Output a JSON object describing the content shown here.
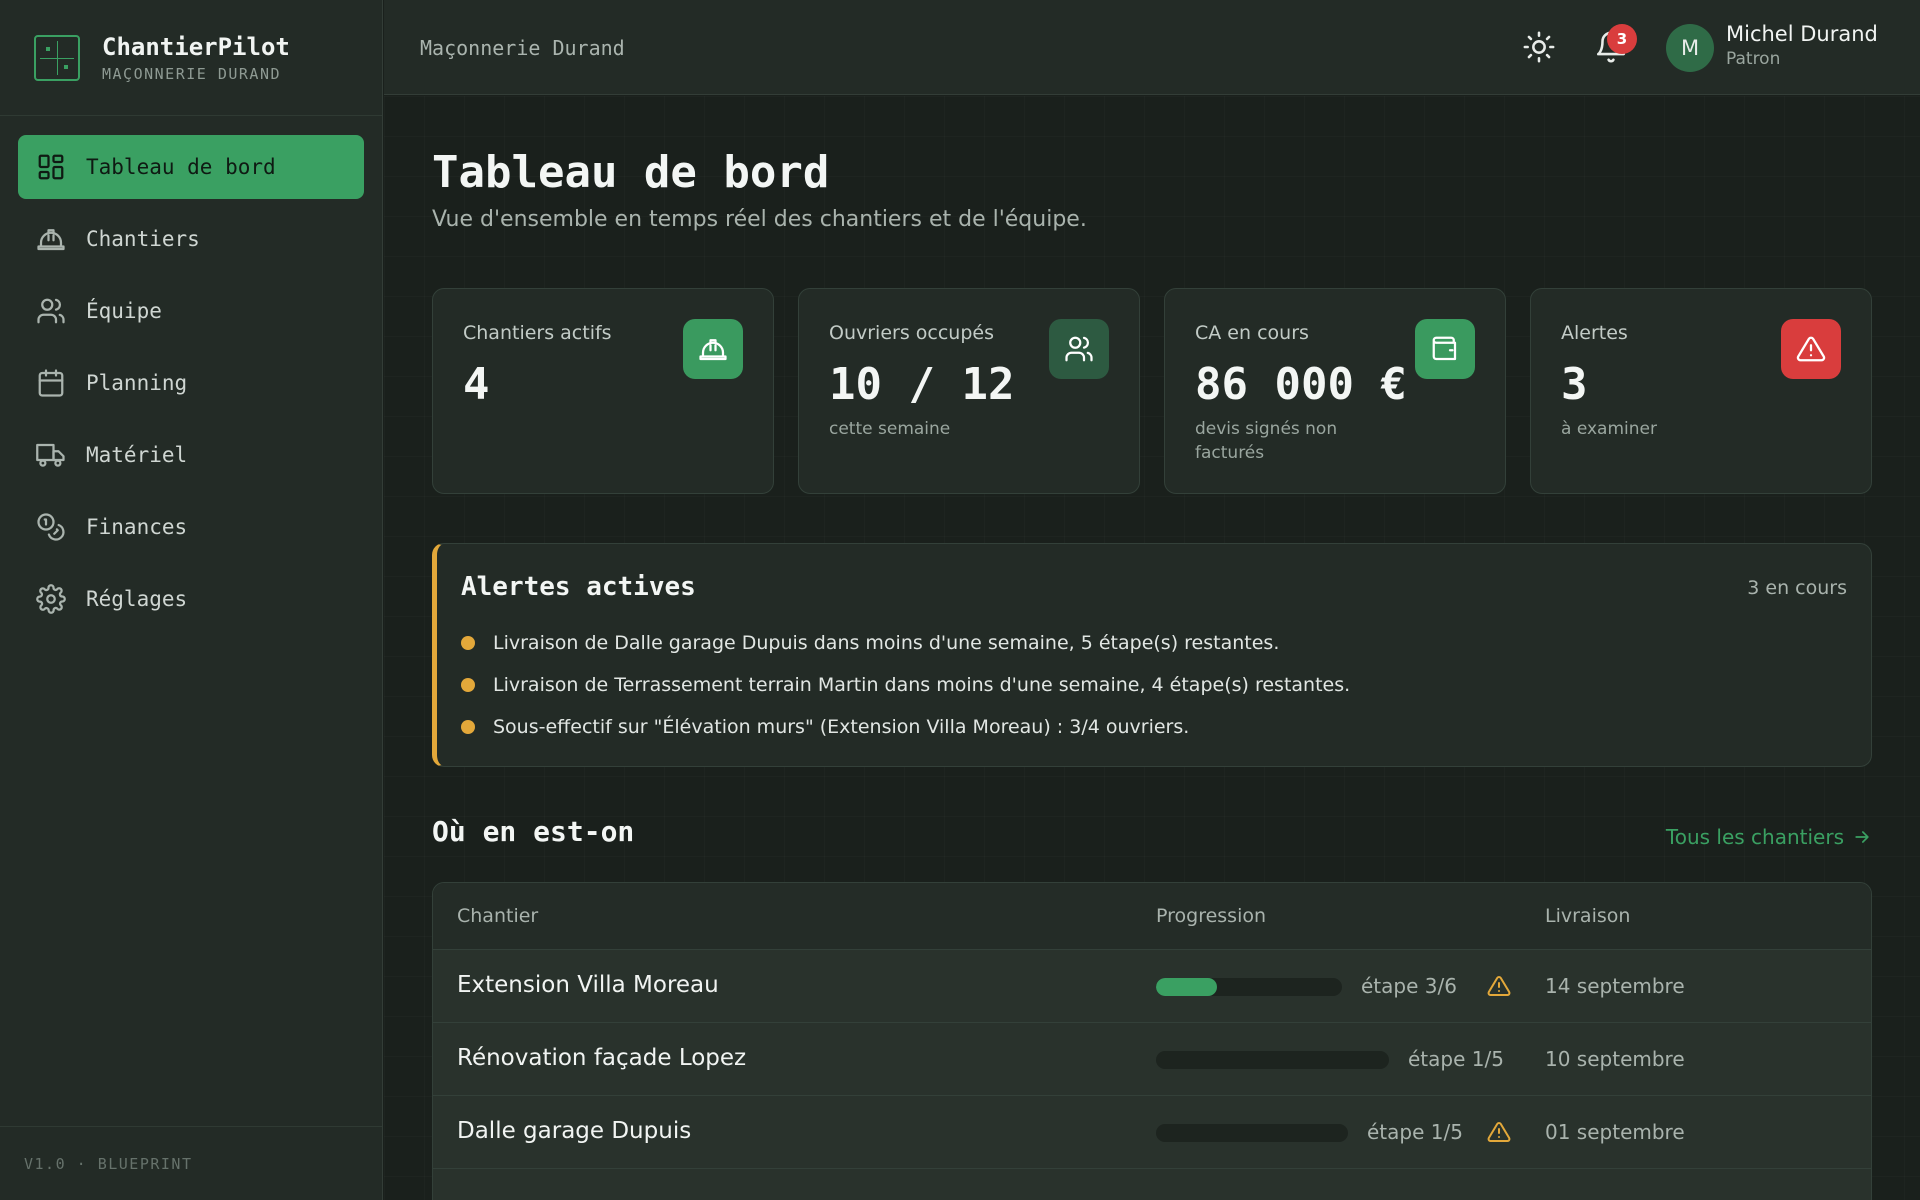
{
  "brand": {
    "name": "ChantierPilot",
    "subtitle": "MAÇONNERIE DURAND"
  },
  "nav": [
    {
      "label": "Tableau de bord",
      "icon": "dashboard-icon",
      "active": true
    },
    {
      "label": "Chantiers",
      "icon": "hardhat-icon"
    },
    {
      "label": "Équipe",
      "icon": "users-icon"
    },
    {
      "label": "Planning",
      "icon": "calendar-icon"
    },
    {
      "label": "Matériel",
      "icon": "truck-icon"
    },
    {
      "label": "Finances",
      "icon": "coins-icon"
    },
    {
      "label": "Réglages",
      "icon": "gear-icon"
    }
  ],
  "footer": {
    "version": "V1.0 · BLUEPRINT"
  },
  "topbar": {
    "org": "Maçonnerie Durand",
    "notifications": "3",
    "user": {
      "initial": "M",
      "name": "Michel Durand",
      "role": "Patron"
    }
  },
  "page": {
    "title": "Tableau de bord",
    "subtitle": "Vue d'ensemble en temps réel des chantiers et de l'équipe."
  },
  "stats": [
    {
      "label": "Chantiers actifs",
      "value": "4",
      "note": "",
      "icon": "hardhat-icon"
    },
    {
      "label": "Ouvriers occupés",
      "value": "10 / 12",
      "note": "cette semaine",
      "icon": "users-icon"
    },
    {
      "label": "CA en cours",
      "value": "86 000 €",
      "note": "devis signés non facturés",
      "icon": "wallet-icon"
    },
    {
      "label": "Alertes",
      "value": "3",
      "note": "à examiner",
      "icon": "warning-icon"
    }
  ],
  "alerts": {
    "title": "Alertes actives",
    "count": "3 en cours",
    "items": [
      "Livraison de Dalle garage Dupuis dans moins d'une semaine, 5 étape(s) restantes.",
      "Livraison de Terrassement terrain Martin dans moins d'une semaine, 4 étape(s) restantes.",
      "Sous-effectif sur \"Élévation murs\" (Extension Villa Moreau) : 3/4 ouvriers."
    ]
  },
  "projects": {
    "title": "Où en est-on",
    "link": "Tous les chantiers",
    "headers": {
      "name": "Chantier",
      "progress": "Progression",
      "delivery": "Livraison"
    },
    "rows": [
      {
        "name": "Extension Villa Moreau",
        "progress": 0.33,
        "step": "étape 3/6",
        "warning": true,
        "date": "14 septembre"
      },
      {
        "name": "Rénovation façade Lopez",
        "progress": 0,
        "step": "étape 1/5",
        "warning": false,
        "date": "10 septembre"
      },
      {
        "name": "Dalle garage Dupuis",
        "progress": 0,
        "step": "étape 1/5",
        "warning": true,
        "date": "01 septembre"
      }
    ]
  },
  "colors": {
    "accent": "#3aa062",
    "warning": "#e3a83a",
    "danger": "#d93d3d"
  }
}
